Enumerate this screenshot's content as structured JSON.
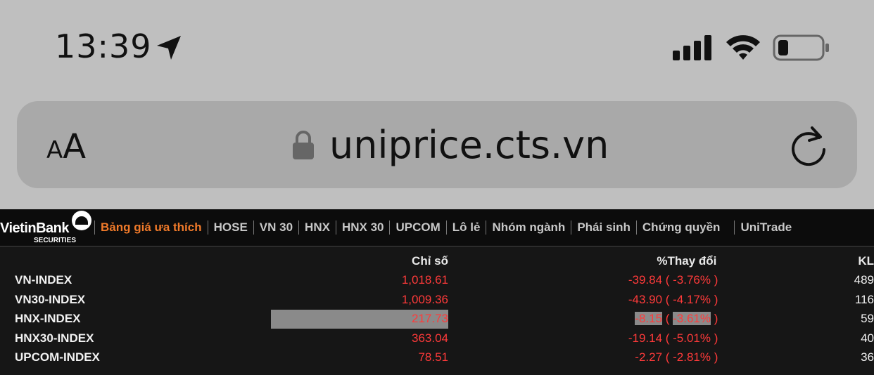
{
  "status_bar": {
    "time": "13:39",
    "icons": [
      "location-arrow-icon",
      "cellular-signal-icon",
      "wifi-icon",
      "battery-icon"
    ]
  },
  "address_bar": {
    "text_size_label_small": "A",
    "text_size_label_big": "A",
    "url": "uniprice.cts.vn",
    "icons": [
      "lock-icon",
      "reload-icon"
    ]
  },
  "logo": {
    "name": "VietinBank",
    "sub": "SECURITIES"
  },
  "nav": {
    "items": [
      "Bảng giá ưa thích",
      "HOSE",
      "VN 30",
      "HNX",
      "HNX 30",
      "UPCOM",
      "Lô lẻ",
      "Nhóm ngành",
      "Phái sinh",
      "Chứng quyền",
      "UniTrade"
    ]
  },
  "table": {
    "headers": {
      "name": "",
      "value": "Chỉ số",
      "change": "%Thay đổi",
      "volume": "KL"
    },
    "rows": [
      {
        "name": "VN-INDEX",
        "value": "1,018.61",
        "chg": "-39.84",
        "pct": "-3.76%",
        "vol": "489"
      },
      {
        "name": "VN30-INDEX",
        "value": "1,009.36",
        "chg": "-43.90",
        "pct": "-4.17%",
        "vol": "116"
      },
      {
        "name": "HNX-INDEX",
        "value": "217.73",
        "chg": "-8.15",
        "pct": "-3.61%",
        "vol": "59"
      },
      {
        "name": "HNX30-INDEX",
        "value": "363.04",
        "chg": "-19.14",
        "pct": "-5.01%",
        "vol": "40"
      },
      {
        "name": "UPCOM-INDEX",
        "value": "78.51",
        "chg": "-2.27",
        "pct": "-2.81%",
        "vol": "36"
      }
    ]
  },
  "colors": {
    "down": "#ff3a3a",
    "active_nav": "#f07a2a",
    "background": "#161616"
  }
}
